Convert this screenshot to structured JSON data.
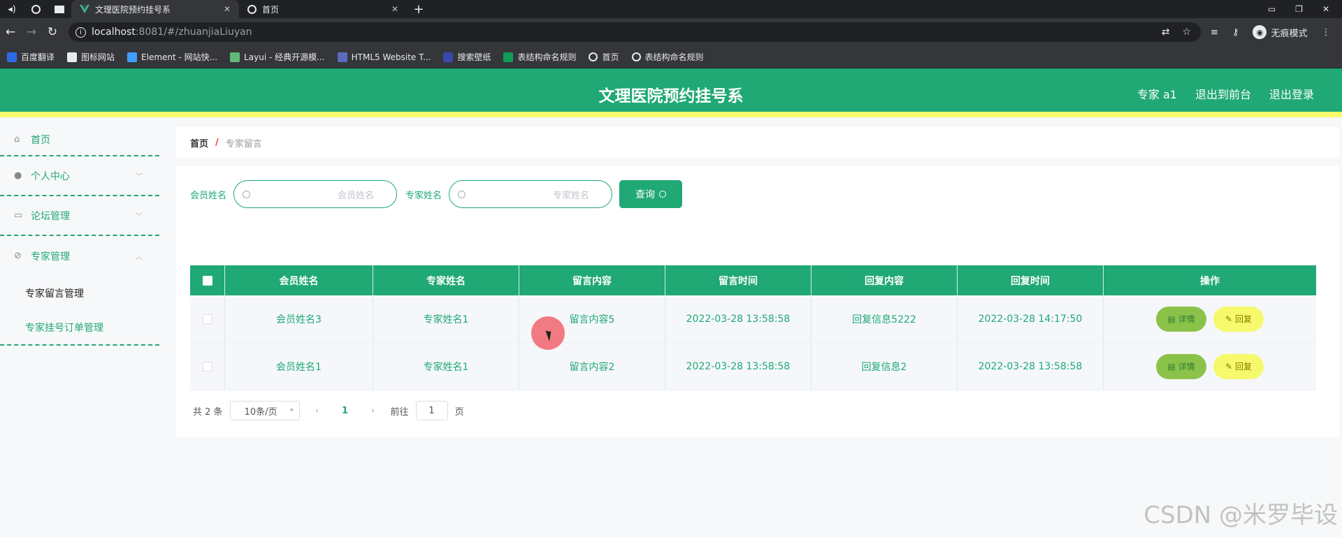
{
  "browser": {
    "tabs": [
      {
        "label": "文理医院预约挂号系"
      },
      {
        "label": "首页"
      }
    ],
    "url_host": "localhost",
    "url_path": ":8081/#/zhuanjiaLiuyan",
    "incognito_label": "无痕模式",
    "bookmarks": [
      {
        "label": "百度翻译",
        "color": "#2d6be5"
      },
      {
        "label": "图标网站",
        "color": "#111111"
      },
      {
        "label": "Element - 网站快...",
        "color": "#409eff"
      },
      {
        "label": "Layui - 经典开源模...",
        "color": "#5fb878"
      },
      {
        "label": "HTML5 Website T...",
        "color": "#5c6bc0"
      },
      {
        "label": "搜索壁纸",
        "color": "#3949ab"
      },
      {
        "label": "表结构命名规则",
        "color": "#0f9d58"
      },
      {
        "label": "首页",
        "color": "#e8eaed"
      },
      {
        "label": "表结构命名规则",
        "color": "#e8eaed"
      }
    ]
  },
  "header": {
    "title": "文理医院预约挂号系",
    "user": "专家 a1",
    "to_front": "退出到前台",
    "logout": "退出登录"
  },
  "sidebar": {
    "items": [
      {
        "label": "首页"
      },
      {
        "label": "个人中心"
      },
      {
        "label": "论坛管理"
      },
      {
        "label": "专家管理"
      }
    ],
    "subitems": [
      {
        "label": "专家留言管理"
      },
      {
        "label": "专家挂号订单管理"
      }
    ]
  },
  "breadcrumb": {
    "home": "首页",
    "sep": "/",
    "current": "专家留言"
  },
  "search": {
    "member_label": "会员姓名",
    "member_placeholder": "会员姓名",
    "expert_label": "专家姓名",
    "expert_placeholder": "专家姓名",
    "query_button": "查询"
  },
  "table": {
    "columns": [
      "会员姓名",
      "专家姓名",
      "留言内容",
      "留言时间",
      "回复内容",
      "回复时间",
      "操作"
    ],
    "rows": [
      {
        "member": "会员姓名3",
        "expert": "专家姓名1",
        "content": "留言内容5",
        "time": "2022-03-28 13:58:58",
        "reply": "回复信息5222",
        "reply_time": "2022-03-28 14:17:50"
      },
      {
        "member": "会员姓名1",
        "expert": "专家姓名1",
        "content": "留言内容2",
        "time": "2022-03-28 13:58:58",
        "reply": "回复信息2",
        "reply_time": "2022-03-28 13:58:58"
      }
    ],
    "detail_label": "详情",
    "reply_label": "回复"
  },
  "pager": {
    "total": "共 2 条",
    "page_size": "10条/页",
    "current_page": "1",
    "goto_label": "前往",
    "goto_value": "1",
    "page_suffix": "页"
  },
  "watermark": "CSDN @米罗毕设",
  "colors": {
    "primary": "#20a875",
    "accent_yellow": "#f6f96b",
    "detail_green": "#8bc34a"
  }
}
